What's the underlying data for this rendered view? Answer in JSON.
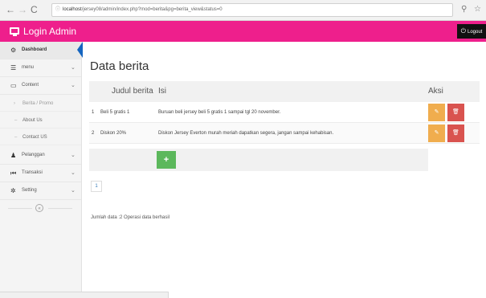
{
  "browser": {
    "url_host": "localhost",
    "url_path": "/jersey08/admin/index.php?mod=berita&pg=berita_view&status=0"
  },
  "header": {
    "logo_text": "Login Admin",
    "logout_label": "Logout",
    "brand_color": "#ee1f8c"
  },
  "sidebar": {
    "items": [
      {
        "label": "Dashboard",
        "icon": "dashboard-icon"
      },
      {
        "label": "menu",
        "icon": "list-icon"
      },
      {
        "label": "Content",
        "icon": "monitor-icon"
      },
      {
        "label": "Pelanggan",
        "icon": "user-icon"
      },
      {
        "label": "Transaksi",
        "icon": "transaction-icon"
      },
      {
        "label": "Setting",
        "icon": "gear-icon"
      }
    ],
    "sub_items": [
      "Berita / Promo",
      "About Us",
      "Contact US"
    ]
  },
  "main": {
    "title": "Data berita",
    "columns": {
      "judul": "Judul berita",
      "isi": "Isi",
      "aksi": "Aksi"
    },
    "rows": [
      {
        "no": "1",
        "judul": "Beli 5 gratis 1",
        "isi": "Buruan beli jersey beli 5 gratis 1 sampai tgl 20 november."
      },
      {
        "no": "2",
        "judul": "Diskon 20%",
        "isi": "Diskon Jersey Everton murah meriah dapatkan segera, jangan sampai kehabisan."
      }
    ],
    "add_label": "+",
    "page": "1",
    "summary": "Jumlah data :2 Operasi data berhasil"
  }
}
